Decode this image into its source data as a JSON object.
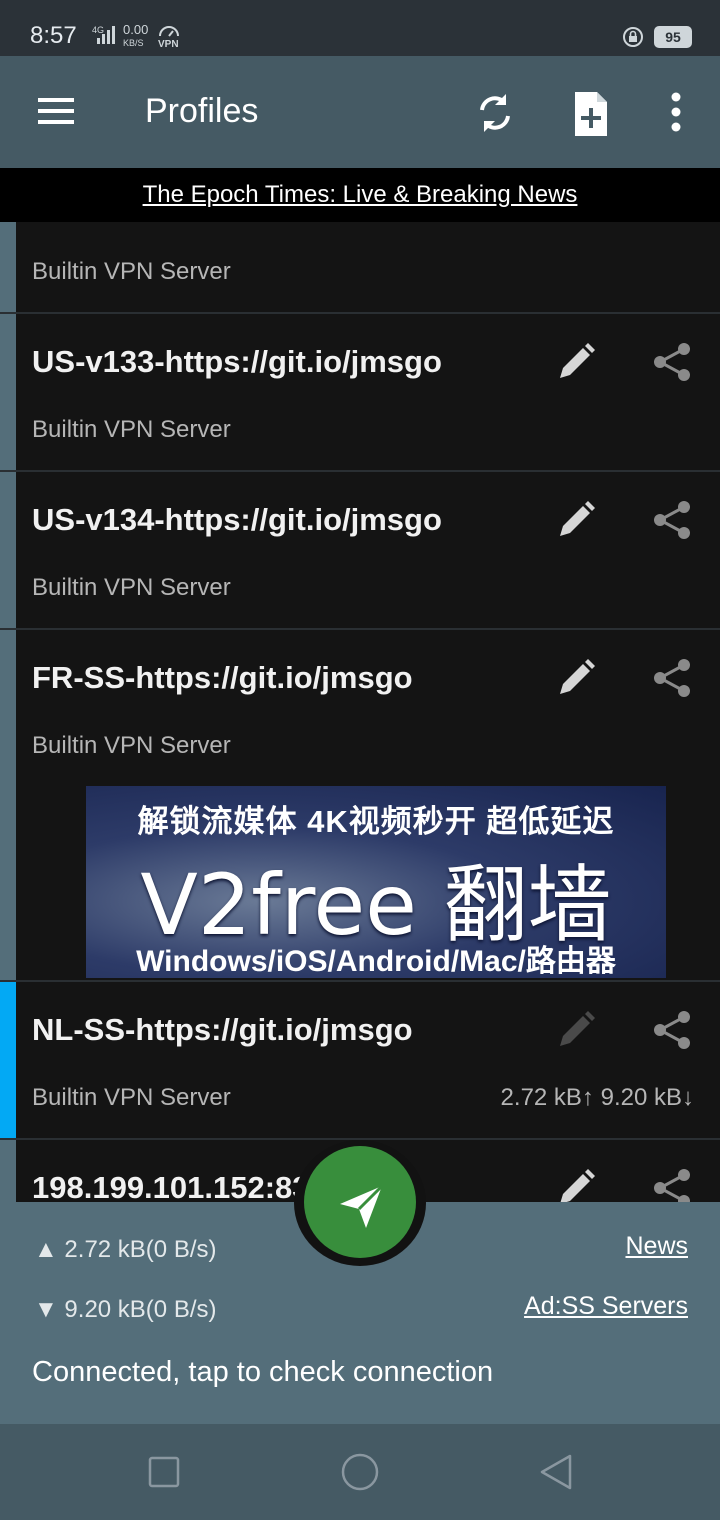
{
  "status_bar": {
    "time": "8:57",
    "speed": "0.00",
    "speed_unit": "KB/S",
    "vpn": "VPN",
    "network": "4G",
    "battery": "95"
  },
  "app_bar": {
    "title": "Profiles",
    "icons": [
      "menu-icon",
      "refresh-icon",
      "add-file-icon",
      "more-vert-icon"
    ]
  },
  "news_banner": {
    "text": "The Epoch Times: Live & Breaking News"
  },
  "profiles": [
    {
      "title": "",
      "subtitle": "Builtin VPN Server",
      "traffic": "",
      "active": false
    },
    {
      "title": "US-v133-https://git.io/jmsgo",
      "subtitle": "Builtin VPN Server",
      "traffic": "",
      "active": false
    },
    {
      "title": "US-v134-https://git.io/jmsgo",
      "subtitle": "Builtin VPN Server",
      "traffic": "",
      "active": false
    },
    {
      "title": "FR-SS-https://git.io/jmsgo",
      "subtitle": "Builtin VPN Server",
      "traffic": "",
      "active": false
    },
    {
      "title": "NL-SS-https://git.io/jmsgo",
      "subtitle": "Builtin VPN Server",
      "traffic": "2.72 kB↑ 9.20 kB↓",
      "active": true
    },
    {
      "title": "198.199.101.152:83",
      "subtitle": "",
      "traffic": "",
      "active": false
    }
  ],
  "ad": {
    "line1": "解锁流媒体  4K视频秒开 超低延迟",
    "line2": "V2free 翻墙",
    "line3": "Windows/iOS/Android/Mac/路由器"
  },
  "bottom_panel": {
    "upload": "▲ 2.72 kB(0 B/s)",
    "download": "▼ 9.20 kB(0 B/s)",
    "news_link": "News",
    "ad_link": "Ad:SS Servers",
    "connection_status": "Connected, tap to check connection"
  },
  "colors": {
    "app_bar": "#455a64",
    "panel": "#546e7a",
    "fab": "#388e3c",
    "active_stripe": "#03a9f4"
  }
}
